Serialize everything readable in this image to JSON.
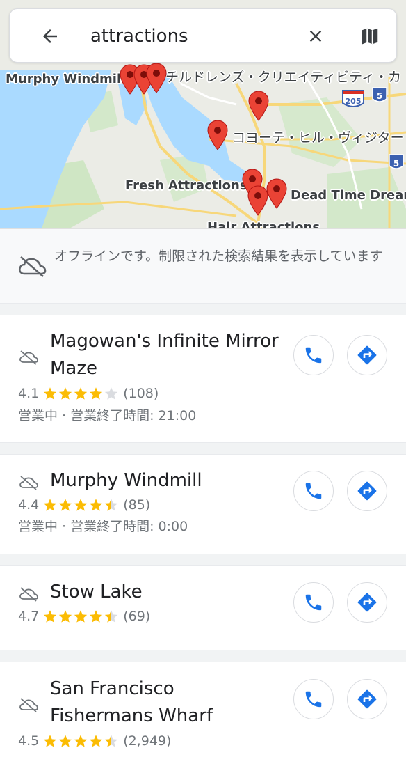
{
  "search": {
    "query": "attractions",
    "back_icon": "arrow-back-icon",
    "clear_icon": "close-icon",
    "map_icon": "map-icon"
  },
  "map": {
    "labels": {
      "murphy": "Murphy Windmill",
      "childrens": "チルドレンズ・クリエイティビティ・カ",
      "coyote": "コヨーテ・ヒル・ヴィジター",
      "fresh": "Fresh Attractions",
      "dead_time": "Dead Time Dream",
      "hair": "Hair Attractions",
      "hwy_205": "205",
      "hwy_5a": "5",
      "hwy_5b": "5"
    },
    "pin_color": "#ea4335"
  },
  "offline": {
    "icon": "cloud-off-icon",
    "message": "オフラインです。制限された検索結果を表示しています"
  },
  "results": [
    {
      "title": "Magowan's Infinite Mirror Maze",
      "rating": "4.1",
      "rating_value": 4.1,
      "reviews": "(108)",
      "hours": "営業中 · 営業終了時間: 21:00"
    },
    {
      "title": "Murphy Windmill",
      "rating": "4.4",
      "rating_value": 4.4,
      "reviews": "(85)",
      "hours": "営業中 · 営業終了時間: 0:00"
    },
    {
      "title": "Stow Lake",
      "rating": "4.7",
      "rating_value": 4.7,
      "reviews": "(69)",
      "hours": ""
    },
    {
      "title": "San Francisco Fishermans Wharf",
      "rating": "4.5",
      "rating_value": 4.5,
      "reviews": "(2,949)",
      "hours": ""
    }
  ],
  "colors": {
    "star": "#fbbc04",
    "star_empty": "#dadce0",
    "action_blue": "#1a73e8"
  }
}
